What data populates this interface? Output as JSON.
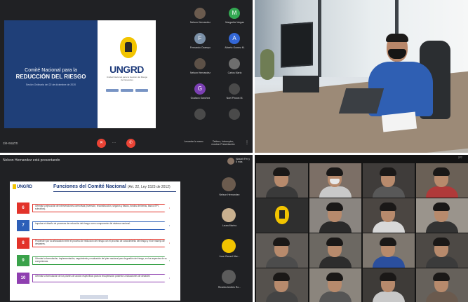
{
  "meet1": {
    "slide": {
      "line1": "Comité Nacional para la",
      "line2": "REDUCCIÓN DEL RIESGO",
      "line3": "Sesión Ordinaria del 22 de diciembre de 2020",
      "logo_text": "UNGRD",
      "logo_sub": "Unidad Nacional para la Gestión del Riesgo de Desastres"
    },
    "participants": [
      {
        "initial": "",
        "name": "Nelson Hernandez",
        "color": "#6b5b4e"
      },
      {
        "initial": "M",
        "name": "Margarita Vargas",
        "color": "#33a852"
      },
      {
        "initial": "F",
        "name": "Fernando Ocampo",
        "color": "#7a8fa6"
      },
      {
        "initial": "A",
        "name": "Alberto Gomez M.",
        "color": "#3367d6"
      },
      {
        "initial": "",
        "name": "Nelson Hernandez",
        "color": "#5d5147"
      },
      {
        "initial": "",
        "name": "Carlos Mario",
        "color": "#6e6e6e"
      },
      {
        "initial": "G",
        "name": "Gustavo Sanchez",
        "color": "#7b3fb3"
      },
      {
        "initial": "",
        "name": "Noel Pinzon M.",
        "color": "#4a4a4a"
      },
      {
        "initial": "",
        "name": "",
        "color": "#4a4a4a"
      },
      {
        "initial": "",
        "name": "",
        "color": "#4a4a4a"
      }
    ],
    "bar": {
      "meeting_name": "cie-wuzrn",
      "hand_label": "Levantar la mano",
      "present_label": "Tablero, Interruptor, mostrar Presentación"
    }
  },
  "meet3": {
    "presenting": "Nelson Hernandez está presentando",
    "you_label": "Nazarit Fer y 5 más",
    "slide": {
      "logo": "UNGRD",
      "title": "Funciones del Comité Nacional",
      "subtitle": "(Art. 22, Ley 1523 de 2012)",
      "rows": [
        {
          "num": "6",
          "text": "Orientar la ejecución de intervenciones correctivas (inversión, reconstrucción, seguros y fiados, fondos de tierras, banco EPI, subsidios).",
          "color": "#e2332a"
        },
        {
          "num": "7",
          "text": "Impulsar el diseño de procesos de reducción del riesgo como componente del sistema nacional.",
          "color": "#2d5fb8"
        },
        {
          "num": "8",
          "text": "Propender por la articulación entre el proceso de reducción del riesgo con el proceso de conocimiento del riesgo y el de manejo de desastres.",
          "color": "#e2332a"
        },
        {
          "num": "9",
          "text": "Orientar la formulación, implementación, seguimiento y evaluación del plan nacional para la gestión del riesgo, en los aspectos de su competencia.",
          "color": "#3aa24a"
        },
        {
          "num": "10",
          "text": "Orientar la formulación de los planes de acción específicos para la recuperación posterior a situaciones de desastre.",
          "color": "#8f3fb0"
        }
      ]
    },
    "side": [
      {
        "name": "Nelson Hernandez",
        "color": "#6b5b4e"
      },
      {
        "name": "Laura Marino",
        "color": "#c9b08f"
      },
      {
        "name": "Jose Gerard Mar...",
        "color": "#f2c400"
      },
      {
        "name": "Ricardo Andres Ro...",
        "color": "#5c5c5c"
      }
    ]
  },
  "grid": {
    "tag": "277",
    "tiles": [
      {
        "name": "",
        "torso": "#3a3a3a",
        "mask": false,
        "logo": false
      },
      {
        "name": "",
        "torso": "#c9c9c9",
        "mask": true,
        "logo": false
      },
      {
        "name": "",
        "torso": "#585858",
        "mask": false,
        "logo": false
      },
      {
        "name": "",
        "torso": "#b03a3a",
        "mask": false,
        "logo": false
      },
      {
        "name": "",
        "torso": "#222",
        "mask": false,
        "logo": true
      },
      {
        "name": "",
        "torso": "#2a2a2a",
        "mask": false,
        "logo": false
      },
      {
        "name": "",
        "torso": "#d8d8d8",
        "mask": false,
        "logo": false
      },
      {
        "name": "",
        "torso": "#333",
        "mask": false,
        "logo": false
      },
      {
        "name": "",
        "torso": "#4c4c4c",
        "mask": false,
        "logo": false
      },
      {
        "name": "",
        "torso": "#2d2d2d",
        "mask": false,
        "logo": false
      },
      {
        "name": "",
        "torso": "#2b4f9e",
        "mask": false,
        "logo": false
      },
      {
        "name": "",
        "torso": "#3b3b3b",
        "mask": false,
        "logo": false
      },
      {
        "name": "",
        "torso": "#444",
        "mask": false,
        "logo": false
      },
      {
        "name": "",
        "torso": "#555",
        "mask": false,
        "logo": false
      },
      {
        "name": "",
        "torso": "#c8c8c8",
        "mask": false,
        "logo": false
      },
      {
        "name": "",
        "torso": "#6a5a4e",
        "mask": false,
        "logo": false
      }
    ]
  }
}
